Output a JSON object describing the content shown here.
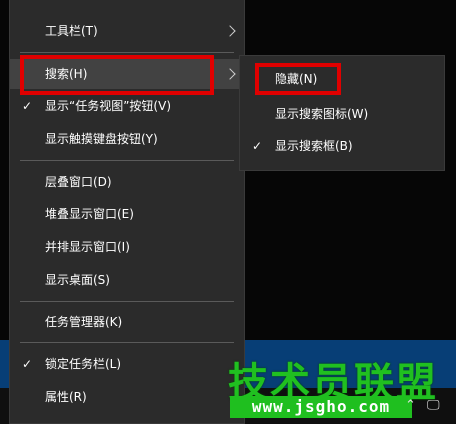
{
  "main_menu": {
    "toolbars": "工具栏(T)",
    "search": "搜索(H)",
    "show_task_view": "显示“任务视图”按钮(V)",
    "show_touch_keyboard": "显示触摸键盘按钮(Y)",
    "cascade": "层叠窗口(D)",
    "stacked": "堆叠显示窗口(E)",
    "side_by_side": "并排显示窗口(I)",
    "show_desktop": "显示桌面(S)",
    "task_manager": "任务管理器(K)",
    "lock_taskbar": "锁定任务栏(L)",
    "properties": "属性(R)"
  },
  "sub_menu": {
    "hidden": "隐藏(N)",
    "show_search_icon": "显示搜索图标(W)",
    "show_search_box": "显示搜索框(B)"
  },
  "check_glyph": "✓",
  "watermark": {
    "title": "技术员联盟",
    "url": "www.jsgho.com"
  },
  "colors": {
    "menu_bg": "#2b2b2b",
    "highlight": "#424242",
    "annotation_red": "#e00000",
    "watermark_green": "#20c020"
  }
}
